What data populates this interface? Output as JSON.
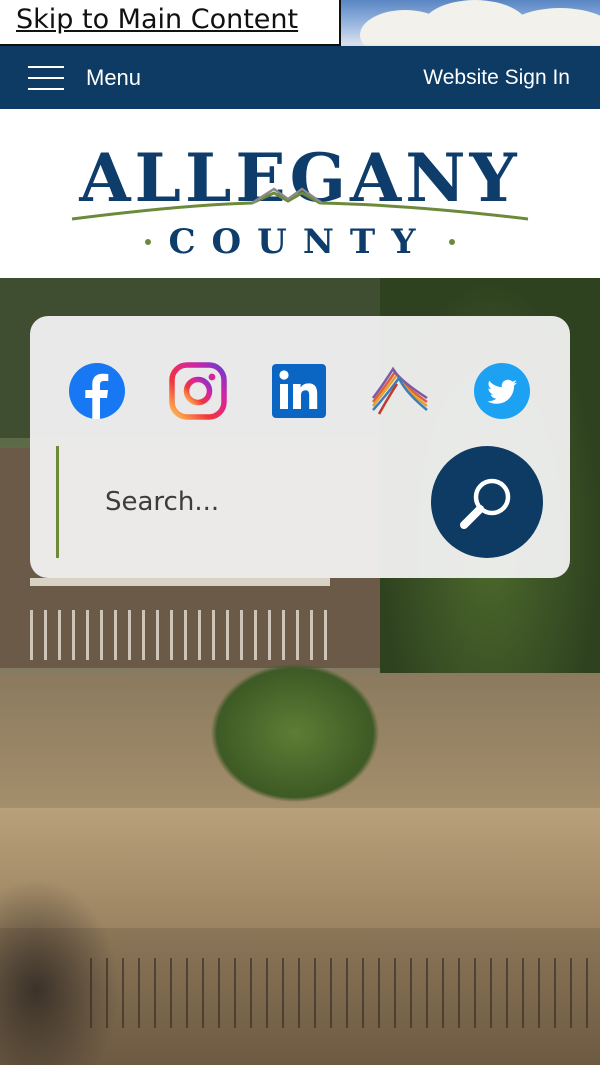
{
  "skip_link": {
    "label": "Skip to Main Content"
  },
  "navbar": {
    "menu_label": "Menu",
    "signin_label": "Website Sign In"
  },
  "logo": {
    "top_text": "ALLEGANY",
    "bottom_text": "COUNTY"
  },
  "social_links": [
    {
      "name": "facebook-icon",
      "color": "#1877f2"
    },
    {
      "name": "instagram-icon",
      "color": "#d6249f"
    },
    {
      "name": "linkedin-icon",
      "color": "#0a66c2"
    },
    {
      "name": "rail-trail-icon",
      "color": "#e0603a"
    },
    {
      "name": "twitter-icon",
      "color": "#1da1f2"
    }
  ],
  "search": {
    "placeholder": "Search...",
    "button_icon": "search-icon"
  },
  "colors": {
    "navy": "#0d3b63",
    "green_accent": "#6d8a3a",
    "logo_blue": "#0f3d6b"
  }
}
